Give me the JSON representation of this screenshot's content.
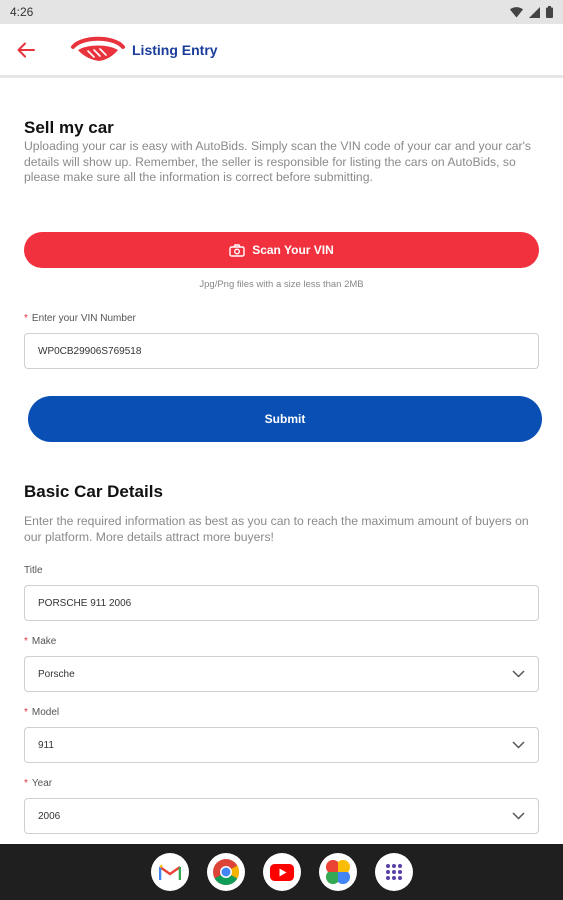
{
  "status_bar": {
    "time": "4:26"
  },
  "app_bar": {
    "title": "Listing Entry"
  },
  "sell": {
    "heading": "Sell my car",
    "description": "Uploading your car is easy with AutoBids. Simply scan the VIN code of your car and your car's details will show up. Remember, the seller is responsible for listing the cars on AutoBids, so please make sure all the information is correct before submitting.",
    "scan_button_label": "Scan Your VIN",
    "file_hint": "Jpg/Png files with a size less than 2MB",
    "vin_label": "Enter your VIN Number",
    "vin_value": "WP0CB29906S769518",
    "submit_label": "Submit"
  },
  "basic": {
    "heading": "Basic Car Details",
    "description": "Enter the required information as best as you can to reach the maximum amount of buyers on our platform. More details attract more buyers!",
    "title_label": "Title",
    "title_value": "PORSCHE 911 2006",
    "make_label": "Make",
    "make_value": "Porsche",
    "model_label": "Model",
    "model_value": "911",
    "year_label": "Year",
    "year_value": "2006"
  },
  "dock": [
    "gmail-icon",
    "chrome-icon",
    "youtube-icon",
    "photos-icon",
    "app-drawer-icon"
  ],
  "colors": {
    "accent_red": "#f1323e",
    "primary_blue": "#0a4fb3",
    "title_blue": "#1a3d9c"
  }
}
